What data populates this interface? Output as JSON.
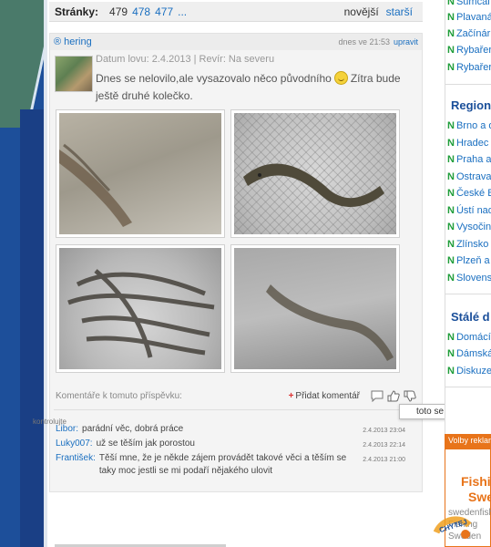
{
  "pager": {
    "label": "Stránky:",
    "current": "479",
    "pages": [
      "478",
      "477",
      "..."
    ],
    "newer": "novější",
    "older": "starší"
  },
  "post": {
    "author": "® hering",
    "posted": "dnes ve 21:53",
    "edit": "upravit",
    "meta": "Datum lovu: 2.4.2013 | Revír: Na severu",
    "text_before": "Dnes se nelovilo,ale vysazovalo něco původního",
    "text_after": "Zítra bude ještě druhé kolečko.",
    "comments_heading": "Komentáře k tomuto příspěvku:",
    "add_comment": "Přidat komentář",
    "tooltip": "toto se mi nelíbí"
  },
  "comments": [
    {
      "who": "Libor:",
      "text": "parádní věc, dobrá práce",
      "when": "2.4.2013 23:04"
    },
    {
      "who": "Luky007:",
      "text": "už se těším jak porostou",
      "when": "2.4.2013 22:14"
    },
    {
      "who": "František:",
      "text": "Těší mne, že je někde zájem provádět takové věci a těším se taky moc jestli se mi podaří nějakého ulovit",
      "when": "2.4.2013 21:00"
    }
  ],
  "sidebar": {
    "top_items": [
      "Sumcai",
      "Plavaná",
      "Začínár",
      "Rybařer",
      "Rybařer"
    ],
    "regional_title": "Region",
    "regional_items": [
      "Brno a o",
      "Hradec",
      "Praha a",
      "Ostrava",
      "České B",
      "Ústí nad",
      "Vysočin",
      "Zlínsko",
      "Plzeň a",
      "Slovens"
    ],
    "constant_title": "Stálé d",
    "constant_items": [
      "Domácí",
      "Dámská",
      "Diskuze"
    ],
    "misc": "kontrolujte",
    "ad_header": "Volby reklam",
    "ad_title_1": "Fishi",
    "ad_title_2": "Swe",
    "ad_sub_1": "swedenfish",
    "ad_sub_2": "Fishing",
    "ad_sub_3": "Sweden",
    "badge": "CHYTEJ"
  },
  "colors": {
    "link": "#1a6fc0",
    "sidebar_n": "#1f9d3a",
    "accent": "#e8741a",
    "left_strip": "#1d4f9a"
  }
}
